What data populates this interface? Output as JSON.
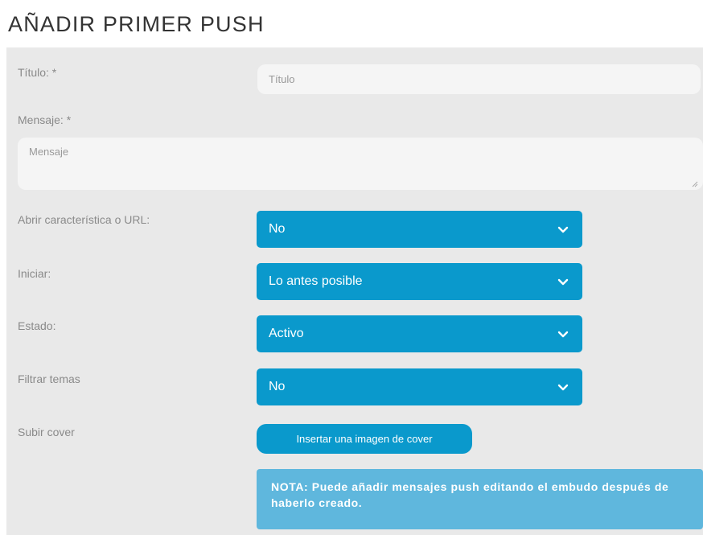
{
  "page": {
    "title": "AÑADIR PRIMER PUSH"
  },
  "form": {
    "title_label": "Título: *",
    "title_placeholder": "Título",
    "message_label": "Mensaje: *",
    "message_placeholder": "Mensaje",
    "open_feature_label": "Abrir característica o URL:",
    "open_feature_value": "No",
    "start_label": "Iniciar:",
    "start_value": "Lo antes posible",
    "status_label": "Estado:",
    "status_value": "Activo",
    "filter_label": "Filtrar temas",
    "filter_value": "No",
    "cover_label": "Subir cover",
    "cover_button": "Insertar una imagen de cover",
    "note": "NOTA: Puede añadir mensajes push editando el embudo después de haberlo creado."
  },
  "colors": {
    "accent": "#0a99cc",
    "note_bg": "#5fb7dd",
    "panel_bg": "#e9e9e9"
  },
  "icons": {
    "select": "chevron-down-icon",
    "textarea": "resize-grip-icon"
  }
}
